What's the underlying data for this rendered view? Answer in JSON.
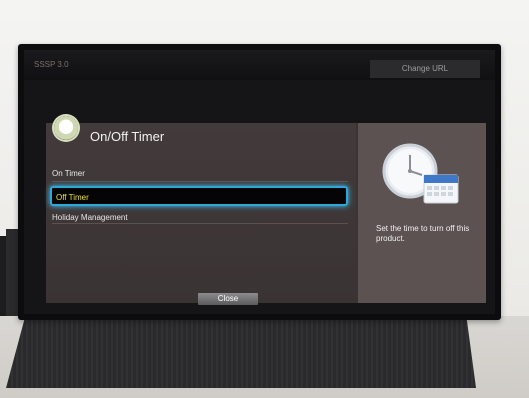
{
  "screen": {
    "app_name": "SSSP 3.0",
    "change_url_label": "Change URL"
  },
  "dialog": {
    "title": "On/Off Timer",
    "menu": {
      "items": [
        {
          "label": "On Timer"
        },
        {
          "label": "Off Timer"
        },
        {
          "label": "Holiday Management"
        }
      ],
      "selected_index": 1
    },
    "close_label": "Close",
    "description": "Set the time to turn off this product.",
    "colors": {
      "highlight_border": "#2ba8d7",
      "selected_text": "#e8e034",
      "panel": "#3a3434",
      "right_panel": "#5b5251"
    },
    "icons": [
      "timer-icon",
      "clock-calendar-icon"
    ]
  }
}
